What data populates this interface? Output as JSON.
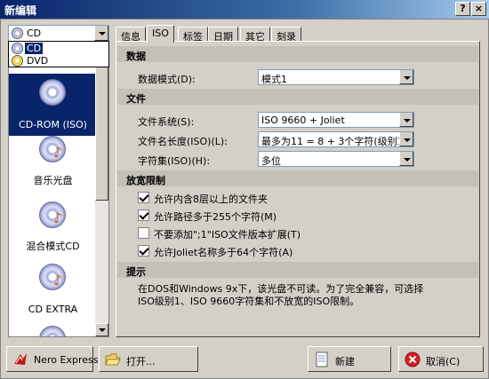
{
  "window": {
    "title": "新编辑",
    "help_label": "?",
    "close_label": "×"
  },
  "media_select": {
    "value": "CD",
    "options": [
      {
        "label": "CD",
        "icon": "cd-disc-icon",
        "selected": true
      },
      {
        "label": "DVD",
        "icon": "dvd-disc-icon",
        "selected": false
      }
    ]
  },
  "categories": [
    {
      "label": "CD-ROM (ISO)",
      "icon": "cd-rom-icon",
      "selected": true
    },
    {
      "label": "音乐光盘",
      "icon": "music-cd-icon",
      "selected": false
    },
    {
      "label": "混合模式CD",
      "icon": "mixed-mode-cd-icon",
      "selected": false
    },
    {
      "label": "CD EXTRA",
      "icon": "cd-extra-icon",
      "selected": false
    }
  ],
  "tabs": [
    {
      "label": "信息",
      "active": false
    },
    {
      "label": "ISO",
      "active": true
    },
    {
      "label": "标签",
      "active": false
    },
    {
      "label": "日期",
      "active": false
    },
    {
      "label": "其它",
      "active": false
    },
    {
      "label": "刻录",
      "active": false
    }
  ],
  "iso": {
    "data_section": "数据",
    "data_mode_label": "数据模式(D):",
    "data_mode_value": "模式1",
    "file_section": "文件",
    "file_system_label": "文件系统(S):",
    "file_system_value": "ISO 9660 + Joliet",
    "filename_length_label": "文件名长度(ISO)(L):",
    "filename_length_value": "最多为11 = 8 + 3个字符(级别1)",
    "charset_label": "字符集(ISO)(H):",
    "charset_value": "多位",
    "relax_section": "放宽限制",
    "options": [
      {
        "label": "允许内含8层以上的文件夹",
        "checked": true
      },
      {
        "label": "允许路径多于255个字符(M)",
        "checked": true
      },
      {
        "label": "不要添加\";1\"ISO文件版本扩展(T)",
        "checked": false
      },
      {
        "label": "允许Joliet名称多于64个字符(A)",
        "checked": true
      }
    ],
    "hint_section": "提示",
    "hint_line1": "在DOS和Windows 9x下，该光盘不可读。为了完全兼容，可选择",
    "hint_line2": "ISO级别1、ISO 9660字符集和不放宽的ISO限制。"
  },
  "buttons": {
    "nero_express": "Nero Express(X)",
    "open": "打开...",
    "new": "新建",
    "cancel": "取消(C)"
  },
  "colors": {
    "selection": "#0a246a",
    "face": "#d4d0c8",
    "titlebar": "#0a246a"
  }
}
